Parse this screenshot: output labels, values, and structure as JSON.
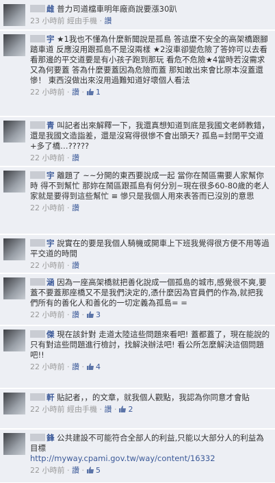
{
  "comments": [
    {
      "author": "雌",
      "text": "普力司道檔車明年廠商說要漲30趴",
      "meta_time": "23 小時前",
      "meta_device": "經由手機",
      "meta_like_label": "讚",
      "likes": ""
    },
    {
      "author": "宇",
      "text": "★1我也不懂為什麼新聞說是孤島 答這麼不安全的高架橋跟腳踏車道 反應沒用跟孤島不是沒兩樣 ★2沒車卻變危險了答妳可以去看看那邊的平交道要是有小孩子跑到那玩 看危不危險★4當時若沒需求又為何要蓋 答為什麼要蓋因為危險而蓋 那知敢出來會比原本沒蓋還慘！ 東西沒做出來沒用過難知道好壞個人看法",
      "meta_time": "22 小時前",
      "meta_device": "",
      "meta_like_label": "讚",
      "likes": "1"
    },
    {
      "author": "青",
      "text": "叫記者出來解釋一下，我還真想知道到底是我國文老師教錯，還是我國文造詣差，還是沒寫得很慘不會出頭天? 孤島=封閉平交道+多了橋…?????",
      "meta_time": "22 小時前",
      "meta_device": "",
      "meta_like_label": "讚",
      "likes": ""
    },
    {
      "author": "宇",
      "text": "離題了 ~~分開的東西要說成一起 當你在鬧區需要人家幫你時 得不到幫忙 那妳在鬧區跟孤島有何分別~現在很多60-80歲的老人家就是要得到這些幫忙 ≡ 慘只是我個人用來表答而已沒別的意思",
      "meta_time": "22 小時前",
      "meta_device": "",
      "meta_like_label": "讚",
      "likes": ""
    },
    {
      "author": "宇",
      "text": "說實在的要是我個人騎機或開車上下班我覺得很方便不用等過平交道的時間",
      "meta_time": "22 小時前",
      "meta_device": "",
      "meta_like_label": "讚",
      "likes": ""
    },
    {
      "author": "涵",
      "text": "因為一座高架橋就把善化說成一個孤島的城市,感覺很不爽,要蓋不要蓋那座橋又不是我們決定的,憑什麼因為官員們的作為,就把我們所有的善化人和善化的一切定義為孤島= =",
      "meta_time": "22 小時前",
      "meta_device": "",
      "meta_like_label": "讚",
      "likes": "3"
    },
    {
      "author": "傑",
      "text": "現在該針對 走道太陸這些問題來看吧! 蓋都蓋了，現在能說的只有對這些問題進行檢討，找解決辦法吧! 看公所怎麼解決這個問題吧!!",
      "meta_time": "22 小時前",
      "meta_device": "",
      "meta_like_label": "讚",
      "likes": "4"
    },
    {
      "author": "軒",
      "text": "貼記者，，的文章，就我個人觀點，我認為你同意才會貼",
      "meta_time": "22 小時前",
      "meta_device": "經由手機",
      "meta_like_label": "讚",
      "likes": "2"
    },
    {
      "author": "鋒",
      "text": "公共建設不可能符合全部人的利益,只能以大部分人的利益為目標",
      "url": "http://myway.cpami.gov.tw/way/content/16332",
      "meta_time": "22 小時前",
      "meta_device": "",
      "meta_like_label": "讚",
      "likes": "5"
    }
  ]
}
